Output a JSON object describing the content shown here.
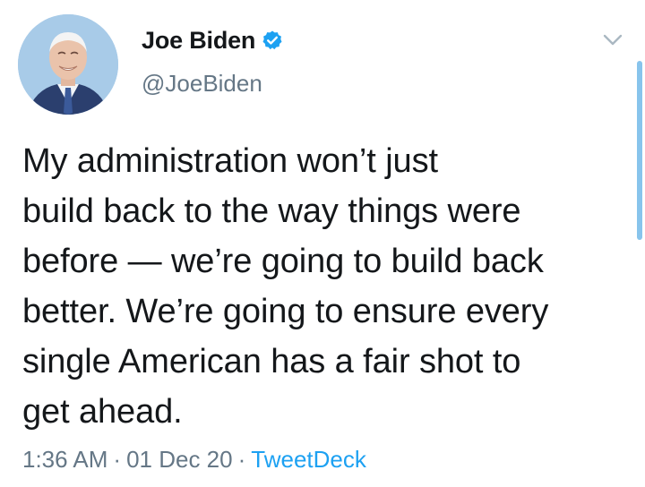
{
  "author": {
    "display_name": "Joe Biden",
    "handle": "@JoeBiden",
    "verified": true,
    "avatar_icon": "profile-photo"
  },
  "tweet": {
    "text": "My administration won’t just\nbuild back to the way things were\nbefore — we’re going to build back\nbetter. We’re going to ensure every\nsingle American has a fair shot to\nget ahead.",
    "time": "1:36 AM",
    "date": "01 Dec 20",
    "separator": "·",
    "source": "TweetDeck"
  },
  "colors": {
    "text": "#14171a",
    "secondary": "#657786",
    "accent": "#1da1f2",
    "verified_badge": "#1da1f2"
  },
  "icons": {
    "more_menu": "chevron-down-icon",
    "verified": "verified-badge-icon"
  }
}
